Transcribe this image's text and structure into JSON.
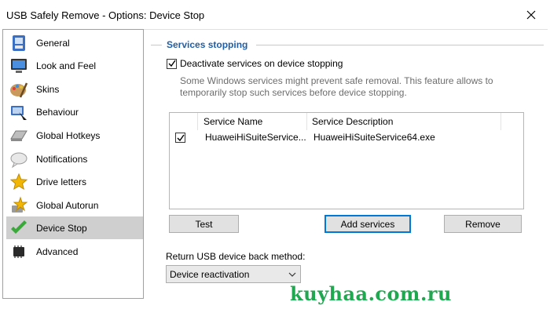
{
  "window": {
    "title": "USB Safely Remove - Options: Device Stop"
  },
  "sidebar": {
    "items": [
      {
        "label": "General",
        "icon": "general-icon",
        "active": false
      },
      {
        "label": "Look and Feel",
        "icon": "monitor-icon",
        "active": false
      },
      {
        "label": "Skins",
        "icon": "palette-icon",
        "active": false
      },
      {
        "label": "Behaviour",
        "icon": "behaviour-icon",
        "active": false
      },
      {
        "label": "Global Hotkeys",
        "icon": "keyboard-icon",
        "active": false
      },
      {
        "label": "Notifications",
        "icon": "cloud-icon",
        "active": false
      },
      {
        "label": "Drive letters",
        "icon": "star-icon",
        "active": false
      },
      {
        "label": "Global Autorun",
        "icon": "autorun-icon",
        "active": false
      },
      {
        "label": "Device Stop",
        "icon": "device-stop-icon",
        "active": true
      },
      {
        "label": "Advanced",
        "icon": "chip-icon",
        "active": false
      }
    ]
  },
  "services": {
    "group_title": "Services stopping",
    "deactivate_label": "Deactivate services on device stopping",
    "deactivate_checked": true,
    "description": "Some Windows services might prevent safe removal. This feature allows to temporarily stop such services before device stopping.",
    "columns": [
      "Service Name",
      "Service Description"
    ],
    "rows": [
      {
        "checked": true,
        "name": "HuaweiHiSuiteService...",
        "description": "HuaweiHiSuiteService64.exe"
      }
    ],
    "buttons": {
      "test": "Test",
      "add": "Add services",
      "remove": "Remove"
    }
  },
  "return_method": {
    "label": "Return USB device back method:",
    "selected": "Device reactivation"
  },
  "watermark": "kuyhaa.com.ru",
  "colors": {
    "accent_title": "#1f5fa8",
    "selection": "#cfcfcf",
    "button_focus": "#0078d7",
    "watermark": "#1fa84f"
  }
}
